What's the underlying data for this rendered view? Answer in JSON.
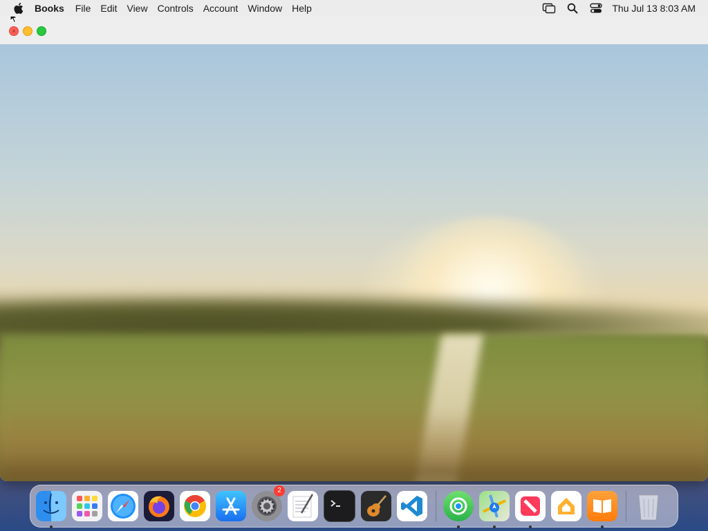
{
  "menubar": {
    "app_name": "Books",
    "items": [
      "File",
      "Edit",
      "View",
      "Controls",
      "Account",
      "Window",
      "Help"
    ],
    "clock": "Thu Jul 13  8:03 AM"
  },
  "dock": {
    "apps": [
      {
        "name": "Finder",
        "running": true
      },
      {
        "name": "Launchpad",
        "running": false
      },
      {
        "name": "Safari",
        "running": false
      },
      {
        "name": "Firefox",
        "running": false
      },
      {
        "name": "Chrome",
        "running": false
      },
      {
        "name": "App Store",
        "running": false
      },
      {
        "name": "System Settings",
        "running": false,
        "badge": "2"
      },
      {
        "name": "TextEdit",
        "running": false
      },
      {
        "name": "Terminal",
        "running": false
      },
      {
        "name": "GarageBand",
        "running": false
      },
      {
        "name": "Visual Studio Code",
        "running": false
      }
    ],
    "recent_apps": [
      {
        "name": "Find My",
        "running": true
      },
      {
        "name": "Maps",
        "running": true
      },
      {
        "name": "News",
        "running": true
      },
      {
        "name": "Home",
        "running": false
      },
      {
        "name": "Books",
        "running": true
      }
    ],
    "trash": {
      "name": "Trash"
    }
  },
  "colors": {
    "close": "#ff5f57",
    "minimize": "#febc2e",
    "zoom": "#28c840",
    "badge": "#ff3b30"
  }
}
